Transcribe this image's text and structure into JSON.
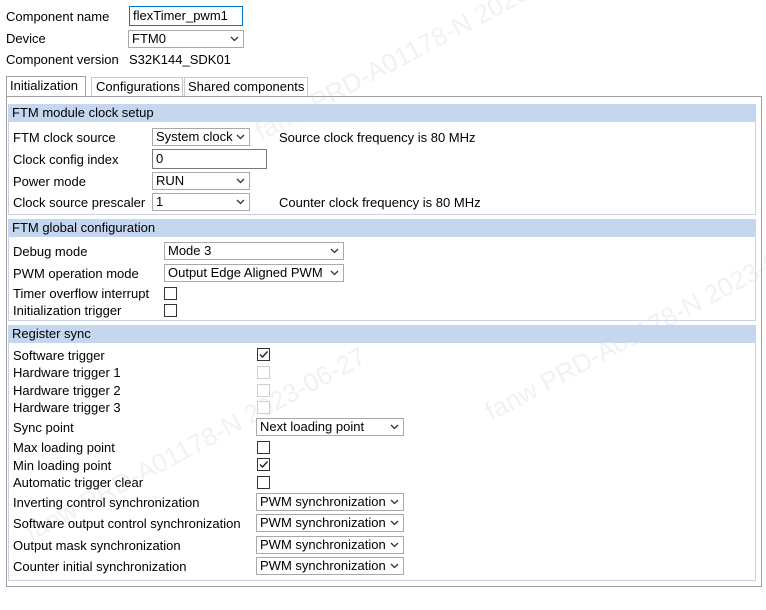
{
  "header": {
    "component_name_label": "Component name",
    "component_name_value": "flexTimer_pwm1",
    "device_label": "Device",
    "device_value": "FTM0",
    "component_version_label": "Component version",
    "component_version_value": "S32K144_SDK01"
  },
  "tabs": [
    "Initialization",
    "Configurations",
    "Shared components"
  ],
  "clock_setup": {
    "title": "FTM module clock setup",
    "clock_source_label": "FTM clock source",
    "clock_source_value": "System clock",
    "source_freq_text": "Source clock frequency is 80 MHz",
    "config_index_label": "Clock config index",
    "config_index_value": "0",
    "power_mode_label": "Power mode",
    "power_mode_value": "RUN",
    "prescaler_label": "Clock source prescaler",
    "prescaler_value": "1",
    "counter_freq_text": "Counter clock frequency is 80 MHz"
  },
  "global_config": {
    "title": "FTM global configuration",
    "debug_mode_label": "Debug mode",
    "debug_mode_value": "Mode 3",
    "pwm_mode_label": "PWM operation mode",
    "pwm_mode_value": "Output Edge Aligned PWM",
    "overflow_label": "Timer overflow interrupt",
    "init_trigger_label": "Initialization trigger"
  },
  "register_sync": {
    "title": "Register sync",
    "software_trigger_label": "Software trigger",
    "hw_trigger1_label": "Hardware trigger 1",
    "hw_trigger2_label": "Hardware trigger 2",
    "hw_trigger3_label": "Hardware trigger 3",
    "sync_point_label": "Sync point",
    "sync_point_value": "Next loading point",
    "max_loading_label": "Max loading point",
    "min_loading_label": "Min loading point",
    "auto_clear_label": "Automatic trigger clear",
    "inverting_label": "Inverting control synchronization",
    "inverting_value": "PWM synchronization",
    "sw_output_label": "Software output control synchronization",
    "sw_output_value": "PWM synchronization",
    "output_mask_label": "Output mask synchronization",
    "output_mask_value": "PWM synchronization",
    "counter_init_label": "Counter initial synchronization",
    "counter_init_value": "PWM synchronization"
  },
  "checkbox_states": {
    "timer_overflow_interrupt": false,
    "initialization_trigger": false,
    "software_trigger": true,
    "hardware_trigger_1": false,
    "hardware_trigger_2": false,
    "hardware_trigger_3": false,
    "max_loading_point": false,
    "min_loading_point": true,
    "automatic_trigger_clear": false
  },
  "watermark_text": "fanw PRD-A01178-N 2023-06-27",
  "colors": {
    "section_header": "#c4d7ef",
    "focus_border": "#0078d7"
  }
}
